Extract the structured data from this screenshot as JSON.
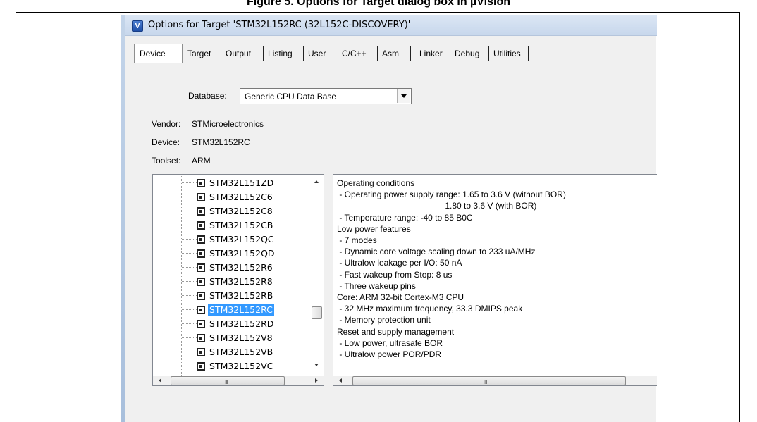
{
  "caption": {
    "text": "Figure 5. Options for Target dialog box in µVision"
  },
  "window": {
    "title": "Options for Target 'STM32L152RC (32L152C-DISCOVERY)'",
    "icon": "keil-uvision-icon"
  },
  "tabs": [
    {
      "label": "Device",
      "active": true
    },
    {
      "label": "Target"
    },
    {
      "label": "Output"
    },
    {
      "label": "Listing"
    },
    {
      "label": "User"
    },
    {
      "label": "C/C++"
    },
    {
      "label": "Asm"
    },
    {
      "label": "Linker"
    },
    {
      "label": "Debug"
    },
    {
      "label": "Utilities"
    }
  ],
  "database": {
    "label": "Database:",
    "selected": "Generic CPU Data Base"
  },
  "vendor": {
    "label": "Vendor:",
    "value": "STMicroelectronics"
  },
  "device": {
    "label": "Device:",
    "value": "STM32L152RC"
  },
  "toolset": {
    "label": "Toolset:",
    "value": "ARM"
  },
  "device_tree": {
    "icon": "chip-icon",
    "items": [
      "STM32L151ZD",
      "STM32L152C6",
      "STM32L152C8",
      "STM32L152CB",
      "STM32L152QC",
      "STM32L152QD",
      "STM32L152R6",
      "STM32L152R8",
      "STM32L152RB",
      "STM32L152RC",
      "STM32L152RD",
      "STM32L152V8",
      "STM32L152VB",
      "STM32L152VC"
    ],
    "selected_index": 9,
    "scrollbar_grip": "III"
  },
  "description": {
    "lines": [
      "Operating conditions",
      " - Operating power supply range: 1.65 to 3.6 V (without BOR)",
      "                                              1.80 to 3.6 V (with BOR)",
      " - Temperature range: -40 to 85 B0C",
      "Low power features",
      " - 7 modes",
      " - Dynamic core voltage scaling down to 233 uA/MHz",
      " - Ultralow leakage per I/O: 50 nA",
      " - Fast wakeup from Stop: 8 us",
      " - Three wakeup pins",
      "Core: ARM 32-bit Cortex-M3 CPU",
      " - 32 MHz maximum frequency, 33.3 DMIPS peak",
      " - Memory protection unit",
      "Reset and supply management",
      " - Low power, ultrasafe BOR",
      " - Ultralow power POR/PDR"
    ],
    "scrollbar_grip": "III"
  },
  "colors": {
    "selection": "#3399ff",
    "dialog_bg": "#f0f0f0",
    "titlebar": "#c7d7ec"
  }
}
